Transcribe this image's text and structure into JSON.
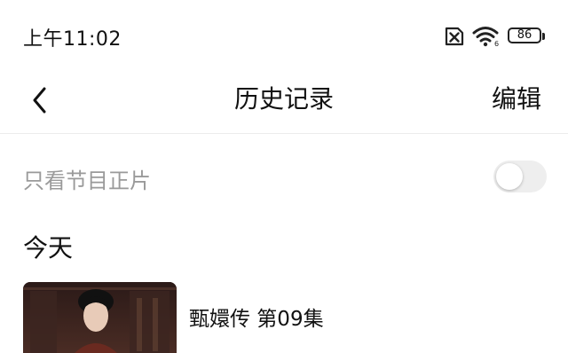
{
  "status_bar": {
    "time": "上午11:02",
    "battery_level": "86",
    "icons": [
      "sim-blocked-icon",
      "wifi-icon",
      "battery-icon"
    ]
  },
  "nav": {
    "back_icon": "chevron-left-icon",
    "title": "历史记录",
    "edit_label": "编辑"
  },
  "filter": {
    "label": "只看节目正片",
    "toggle_on": false
  },
  "sections": [
    {
      "title": "今天",
      "items": [
        {
          "title": "甄嬛传 第09集"
        }
      ]
    }
  ],
  "colors": {
    "background": "#ffffff",
    "text_primary": "#111111",
    "text_secondary": "#9a9a9a",
    "toggle_off": "#eeeeee",
    "divider": "#ececec"
  }
}
